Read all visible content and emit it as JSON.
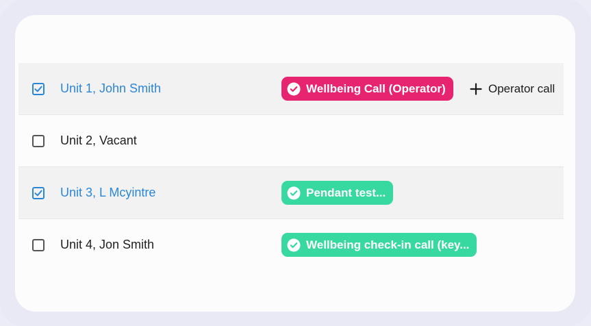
{
  "rows": [
    {
      "label": "Unit 1, John Smith",
      "selected": true,
      "tag": {
        "text": "Wellbeing Call (Operator)",
        "color": "#e6246f"
      },
      "action": "Operator call"
    },
    {
      "label": "Unit 2, Vacant",
      "selected": false
    },
    {
      "label": "Unit 3, L Mcyintre",
      "selected": true,
      "tag": {
        "text": "Pendant test...",
        "color": "#38d9a0"
      }
    },
    {
      "label": "Unit 4, Jon Smith",
      "selected": false,
      "tag": {
        "text": "Wellbeing check-in call (key...",
        "color": "#38d9a0"
      }
    }
  ],
  "colors": {
    "selected_text": "#2c86d6",
    "selected_row_bg": "#f2f2f2",
    "checkbox_checked": "#2c86d6",
    "checkbox_unchecked": "#555555"
  },
  "icons": {
    "checked": "checkbox-checked-icon",
    "unchecked": "checkbox-unchecked-icon",
    "tag_check": "check-circle-icon",
    "add": "plus-icon"
  }
}
